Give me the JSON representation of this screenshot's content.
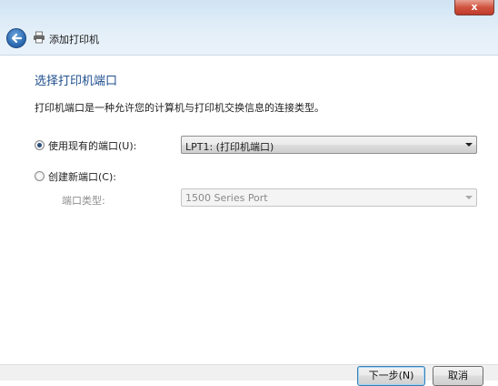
{
  "window": {
    "title": "添加打印机",
    "close_symbol": "x"
  },
  "page": {
    "heading": "选择打印机端口",
    "description": "打印机端口是一种允许您的计算机与打印机交换信息的连接类型。"
  },
  "existing_port": {
    "label": "使用现有的端口(U):",
    "selected": "LPT1: (打印机端口)",
    "checked": true
  },
  "new_port": {
    "label": "创建新端口(C):",
    "checked": false
  },
  "port_type": {
    "label": "端口类型:",
    "selected": "1500 Series Port",
    "enabled": false
  },
  "buttons": {
    "next": "下一步(N)",
    "cancel": "取消"
  },
  "colors": {
    "heading": "#1e4e8c",
    "close_red": "#c0392b",
    "accent_blue": "#2f6db4"
  },
  "icons": {
    "back": "back-arrow-icon",
    "printer": "printer-icon",
    "close": "close-icon"
  }
}
